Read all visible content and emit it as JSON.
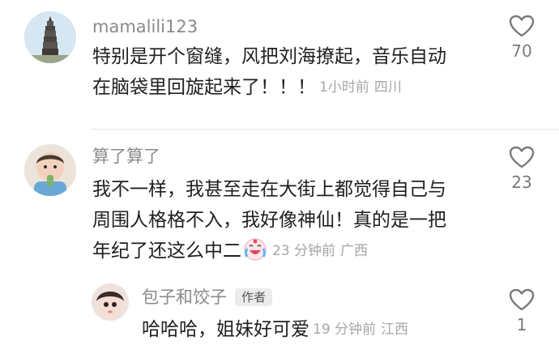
{
  "comments": [
    {
      "username": "mamalili123",
      "lines": [
        "特别是开个窗缝，风把刘海撩起，音乐自动",
        "在脑袋里回旋起来了！！！"
      ],
      "time": "1小时前",
      "location": "四川",
      "likes": "70"
    },
    {
      "username": "算了算了",
      "lines": [
        "我不一样，我甚至走在大街上都觉得自己与",
        "周围人格格不入，我好像神仙！真的是一把",
        "年纪了还这么中二"
      ],
      "emoji": "crying-laughing-emoji",
      "time": "23 分钟前",
      "location": "广西",
      "likes": "23"
    }
  ],
  "reply": {
    "username": "包子和饺子",
    "badge": "作者",
    "text": "哈哈哈，姐妹好可爱",
    "time": "19 分钟前",
    "location": "江西",
    "likes": "1"
  },
  "colors": {
    "username": "#8a8a8a",
    "text": "#1f1f1f",
    "meta": "#a6a6a6"
  }
}
